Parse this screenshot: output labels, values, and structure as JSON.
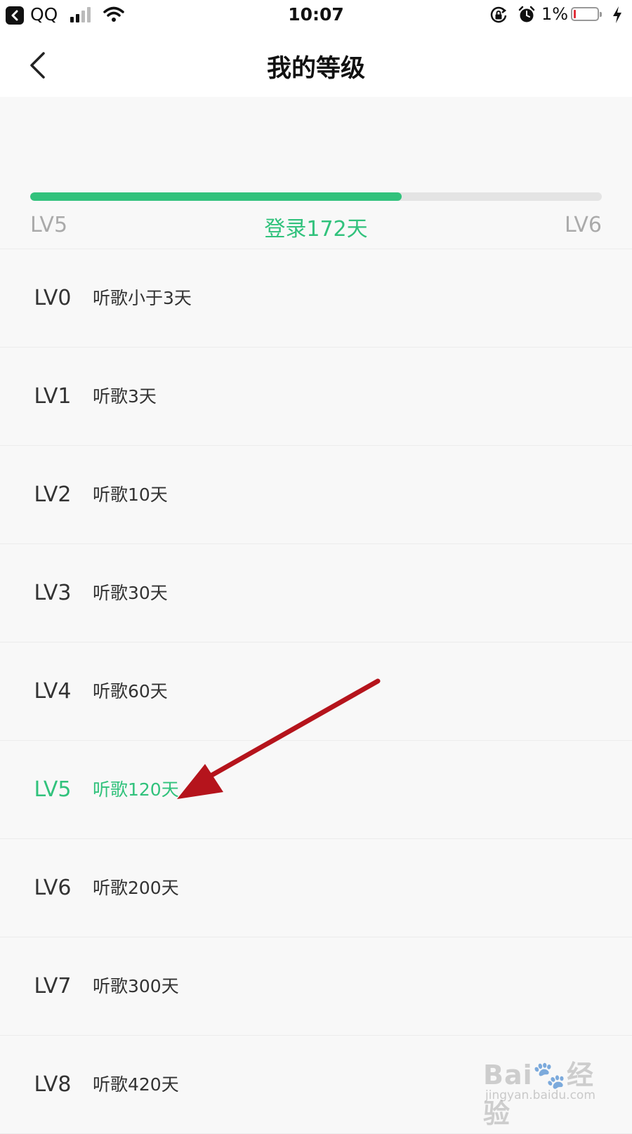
{
  "status_bar": {
    "app_name": "QQ",
    "time": "10:07",
    "battery_percent": "1%",
    "battery_level": 0.01,
    "battery_color": "#e0303a",
    "icons": [
      "back-to-app-icon",
      "signal-icon",
      "wifi-icon",
      "rotation-lock-icon",
      "alarm-icon",
      "battery-icon",
      "charging-bolt-icon"
    ]
  },
  "nav": {
    "title": "我的等级",
    "back_icon": "chevron-left-icon"
  },
  "progress": {
    "current_level": "LV5",
    "next_level": "LV6",
    "status_text": "登录172天",
    "fraction": 0.65,
    "color": "#31c27c"
  },
  "levels": [
    {
      "name": "LV0",
      "requirement": "听歌小于3天"
    },
    {
      "name": "LV1",
      "requirement": "听歌3天"
    },
    {
      "name": "LV2",
      "requirement": "听歌10天"
    },
    {
      "name": "LV3",
      "requirement": "听歌30天"
    },
    {
      "name": "LV4",
      "requirement": "听歌60天"
    },
    {
      "name": "LV5",
      "requirement": "听歌120天",
      "current": true
    },
    {
      "name": "LV6",
      "requirement": "听歌200天"
    },
    {
      "name": "LV7",
      "requirement": "听歌300天"
    },
    {
      "name": "LV8",
      "requirement": "听歌420天"
    }
  ],
  "annotation": {
    "arrow_color": "#b5141c",
    "points_to": "LV5"
  },
  "watermark": {
    "logo_text": "Bai",
    "logo_text_2": "经验",
    "url": "jingyan.baidu.com"
  },
  "theme": {
    "accent": "#31c27c",
    "background": "#f8f8f8"
  }
}
